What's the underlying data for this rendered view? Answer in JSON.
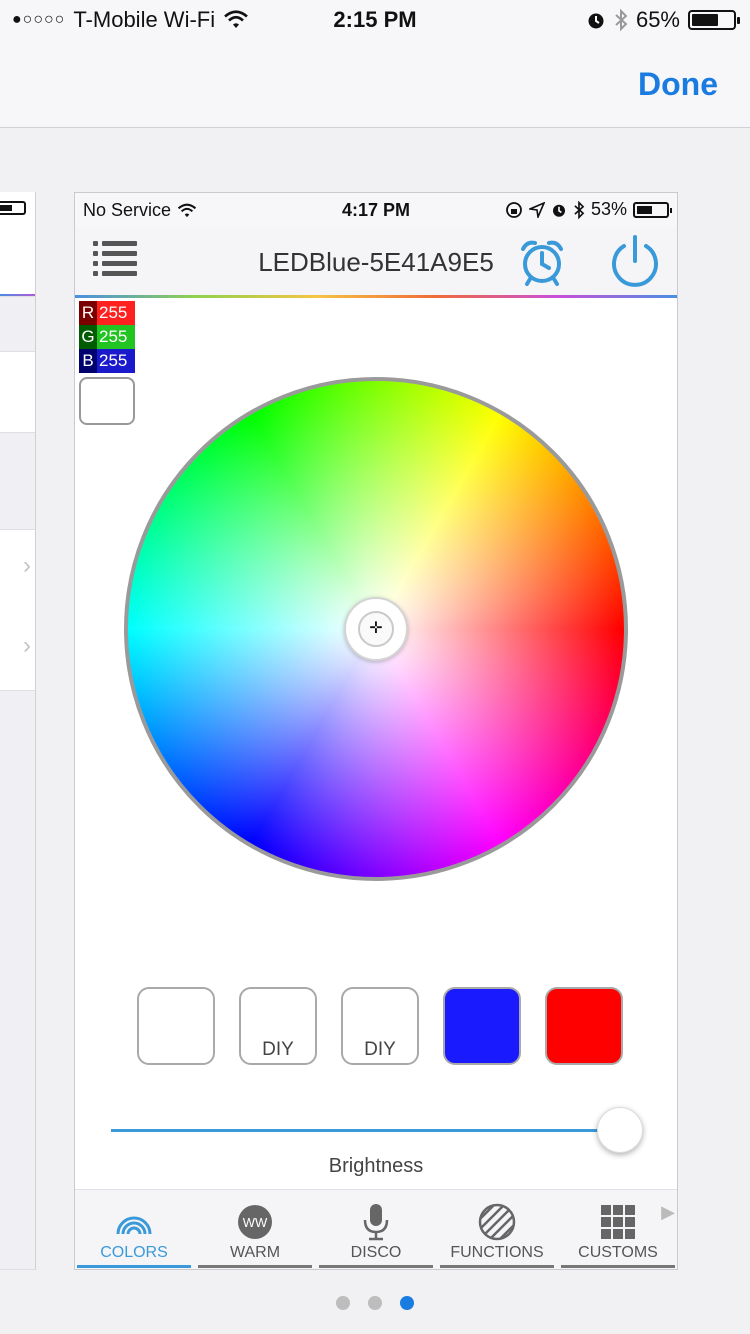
{
  "outer_status": {
    "carrier": "T-Mobile Wi-Fi",
    "time": "2:15 PM",
    "battery": "65%",
    "battery_level": 0.65
  },
  "nav": {
    "done_label": "Done"
  },
  "inner_status": {
    "carrier": "No Service",
    "time": "4:17 PM",
    "battery": "53%",
    "battery_level": 0.53
  },
  "app": {
    "title": "LEDBlue-5E41A9E5"
  },
  "rgb": {
    "r_label": "R",
    "r_value": "255",
    "g_label": "G",
    "g_value": "255",
    "b_label": "B",
    "b_value": "255"
  },
  "swatches": [
    {
      "label": "",
      "color": "#ffffff"
    },
    {
      "label": "DIY",
      "color": "#ffffff"
    },
    {
      "label": "DIY",
      "color": "#ffffff"
    },
    {
      "label": "",
      "color": "#1a1aff"
    },
    {
      "label": "",
      "color": "#ff0000"
    }
  ],
  "brightness": {
    "label": "Brightness",
    "value": 1.0
  },
  "tabs": [
    {
      "label": "COLORS",
      "icon": "rainbow-icon",
      "active": true
    },
    {
      "label": "WARM",
      "icon": "ww-icon",
      "icon_text": "WW"
    },
    {
      "label": "DISCO",
      "icon": "microphone-icon"
    },
    {
      "label": "FUNCTIONS",
      "icon": "striped-circle-icon"
    },
    {
      "label": "CUSTOMS",
      "icon": "grid-icon"
    }
  ],
  "pager": {
    "total": 3,
    "current": 3
  },
  "colors": {
    "accent": "#1a7ce0",
    "tab_active": "#3a9ad9"
  }
}
